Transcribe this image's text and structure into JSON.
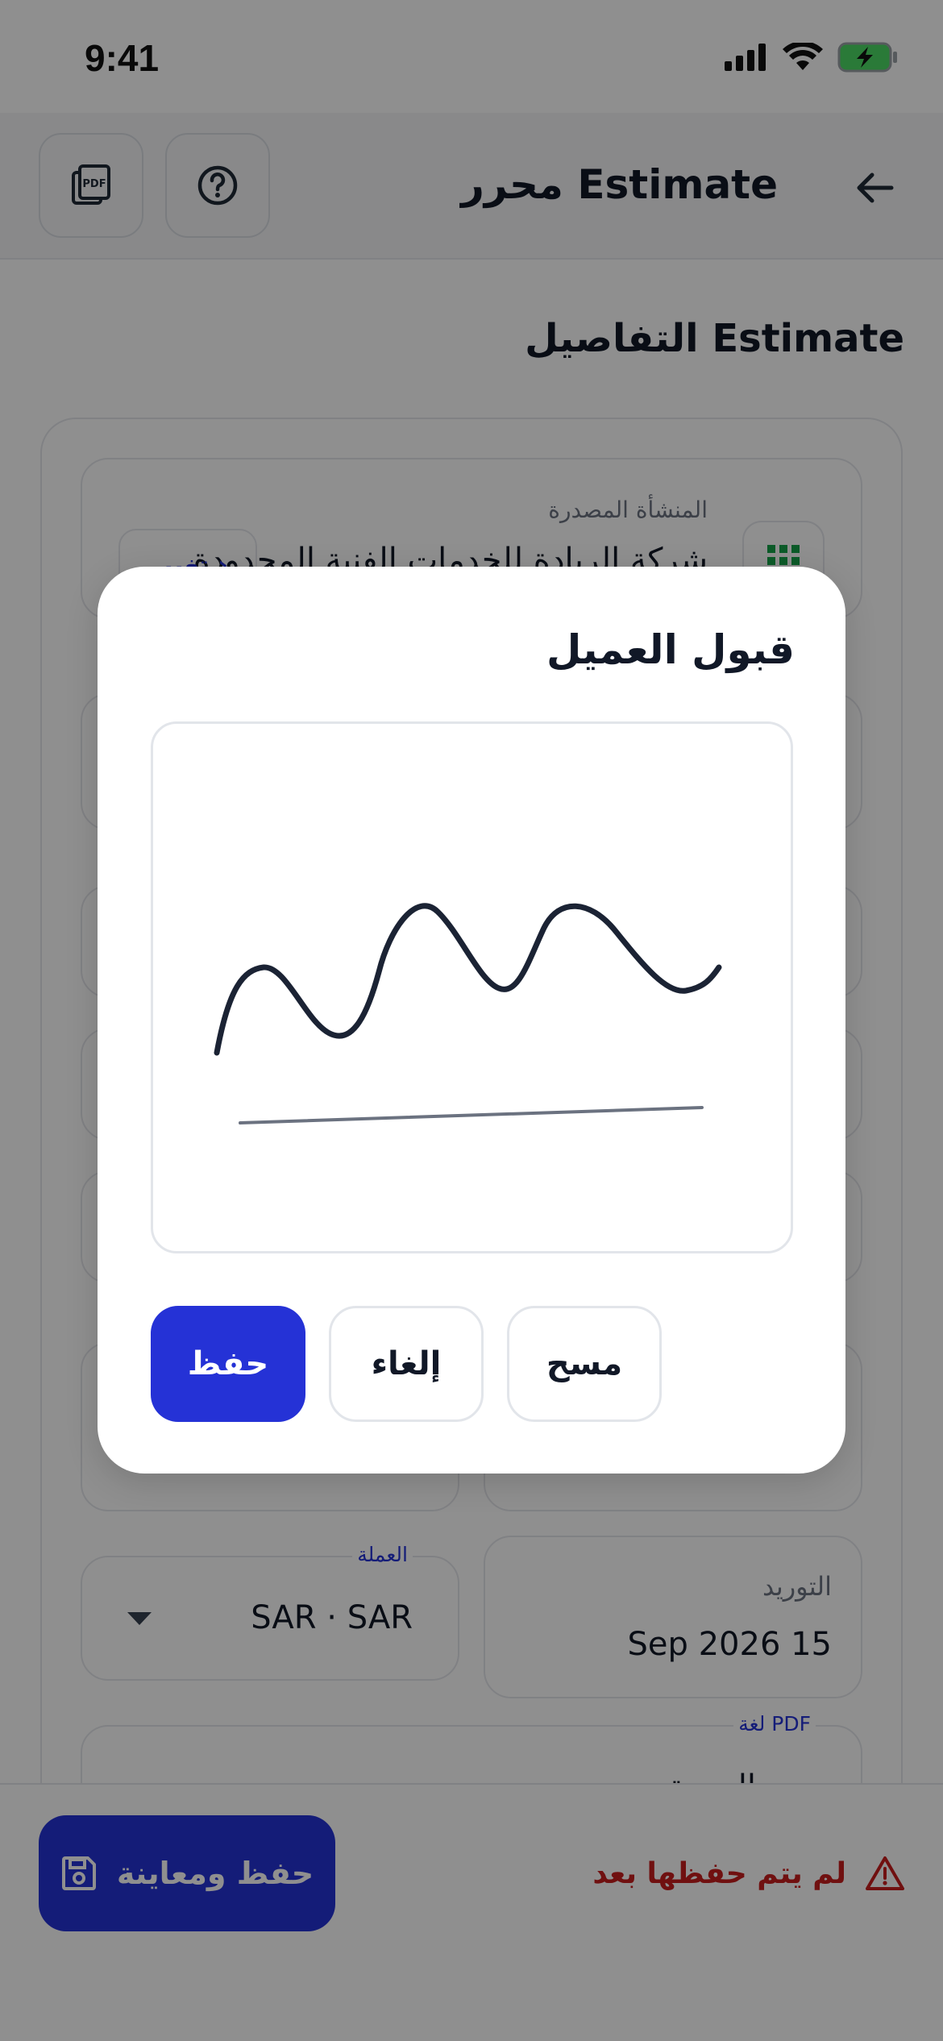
{
  "status_bar": {
    "time": "9:41"
  },
  "header": {
    "title": "Estimate محرر",
    "pdf_icon": "pdf-icon",
    "help_icon": "help-circle-icon",
    "back_icon": "arrow-left-icon"
  },
  "page": {
    "section_title": "Estimate التفاصيل",
    "issuer": {
      "label": "المنشأة المصدرة",
      "value": "شركة الريادة للخدمات الفنية المحدودة",
      "change_label": "تغيير ›"
    },
    "currency": {
      "label": "العملة",
      "value": "SAR · SAR"
    },
    "supply_date": {
      "label": "التوريد",
      "value": "Sep 2026 15"
    },
    "pdf_language": {
      "label": "PDF لغة",
      "value": "العربية"
    }
  },
  "bottom_bar": {
    "save_preview_label": "حفظ ومعاينة",
    "unsaved_text": "لم يتم حفظها بعد"
  },
  "modal": {
    "title": "قبول العميل",
    "buttons": {
      "save": "حفظ",
      "cancel": "إلغاء",
      "clear": "مسح"
    }
  },
  "colors": {
    "primary": "#2532d6",
    "warning": "#c81e1e",
    "ink": "#1b2334",
    "baseline": "#6b7280"
  }
}
